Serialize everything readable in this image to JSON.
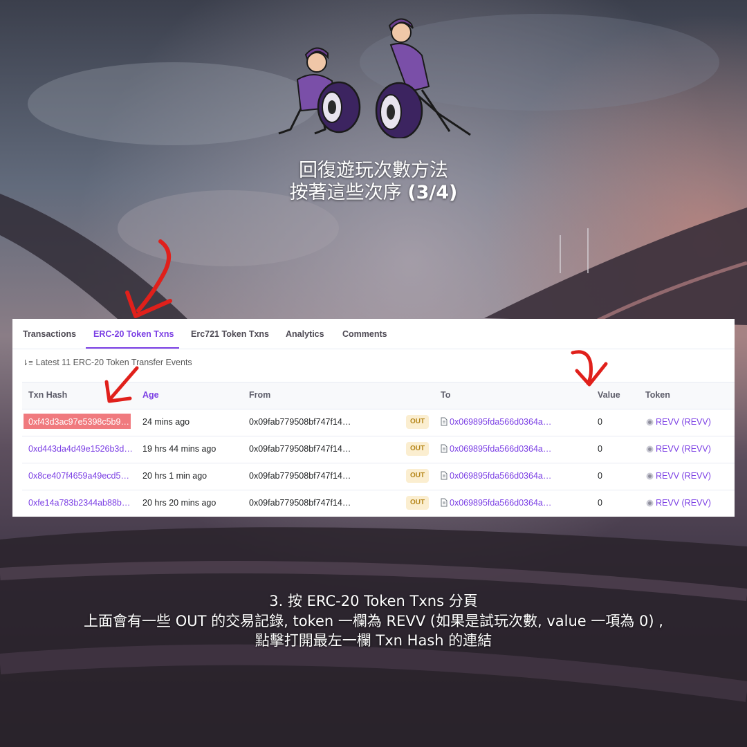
{
  "title": {
    "line1": "回復遊玩次數方法",
    "line2_prefix": "按著這些次序 ",
    "line2_step": "(3/4)"
  },
  "tabs": [
    {
      "label": "Transactions",
      "active": false
    },
    {
      "label": "ERC-20 Token Txns",
      "active": true
    },
    {
      "label": "Erc721 Token Txns",
      "active": false
    },
    {
      "label": "Analytics",
      "active": false
    },
    {
      "label": "Comments",
      "active": false
    }
  ],
  "subheading": "Latest 11 ERC-20 Token Transfer Events",
  "columns": [
    "Txn Hash",
    "Age",
    "From",
    "To",
    "Value",
    "Token"
  ],
  "rows": [
    {
      "hash": "0xf43d3ac97e5398c5b9…",
      "age": "24 mins ago",
      "from": "0x09fab779508bf747f14…",
      "direction": "OUT",
      "to": "0x069895fda566d0364a…",
      "value": "0",
      "token": "REVV (REVV)",
      "highlighted": true
    },
    {
      "hash": "0xd443da4d49e1526b3d…",
      "age": "19 hrs 44 mins ago",
      "from": "0x09fab779508bf747f14…",
      "direction": "OUT",
      "to": "0x069895fda566d0364a…",
      "value": "0",
      "token": "REVV (REVV)",
      "highlighted": false
    },
    {
      "hash": "0x8ce407f4659a49ecd5…",
      "age": "20 hrs 1 min ago",
      "from": "0x09fab779508bf747f14…",
      "direction": "OUT",
      "to": "0x069895fda566d0364a…",
      "value": "0",
      "token": "REVV (REVV)",
      "highlighted": false
    },
    {
      "hash": "0xfe14a783b2344ab88b…",
      "age": "20 hrs 20 mins ago",
      "from": "0x09fab779508bf747f14…",
      "direction": "OUT",
      "to": "0x069895fda566d0364a…",
      "value": "0",
      "token": "REVV (REVV)",
      "highlighted": false
    }
  ],
  "caption": {
    "line1": "3.  按 ERC-20 Token Txns 分頁",
    "line2": "上面會有一些 OUT 的交易記錄, token 一欄為 REVV (如果是試玩次數, value 一項為 0) ,",
    "line3": "點擊打開最左一欄 Txn Hash 的連結"
  },
  "colors": {
    "accent": "#7b3fe4",
    "highlight": "#f07a7e",
    "annotation_arrow": "#e0201b",
    "out_badge_bg": "#fbeed0",
    "out_badge_text": "#b5861a"
  },
  "icons": [
    "sort-icon",
    "contract-doc-icon",
    "revv-token-icon",
    "pit-crew-illustration",
    "red-arrow-annotation"
  ]
}
